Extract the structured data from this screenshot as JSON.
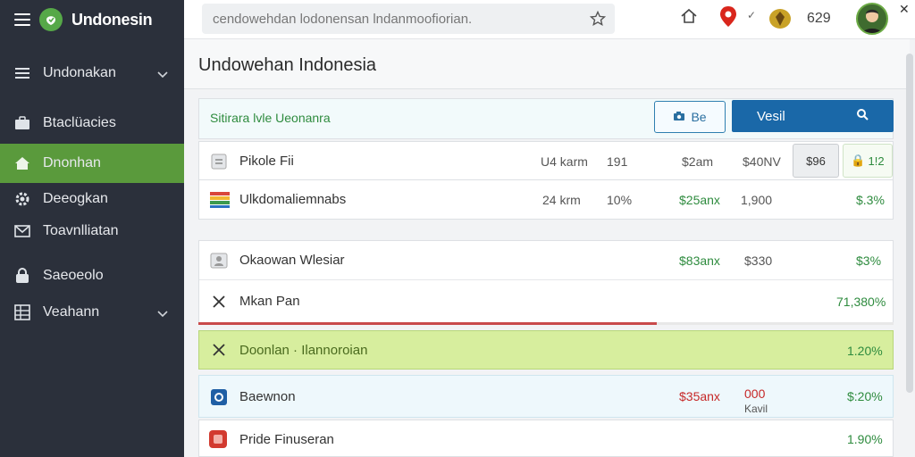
{
  "app": {
    "name": "Undonesin"
  },
  "sidebar": {
    "items": [
      {
        "label": "Undonakan",
        "icon": "list-icon",
        "chevron": true
      },
      {
        "label": "Btaclüacies",
        "icon": "briefcase-icon"
      },
      {
        "label": "Dnonhan",
        "icon": "home-icon",
        "active": true
      },
      {
        "label": "Deeogkan",
        "icon": "gear-icon"
      },
      {
        "label": "Toavnlliatan",
        "icon": "mail-icon"
      },
      {
        "label": "Saeoeolo",
        "icon": "lock-icon"
      },
      {
        "label": "Veahann",
        "icon": "grid-icon",
        "chevron": true
      }
    ]
  },
  "topbar": {
    "search_placeholder": "cendowehdan lodonensan lndanmoofiorian.",
    "count": "629"
  },
  "page": {
    "title": "Undowehan Indonesia"
  },
  "toolbar": {
    "label": "Sitirara lvle Ueonanra",
    "small_button": "Be",
    "primary_button": "Vesil"
  },
  "rows": [
    {
      "name": "Pikole Fii",
      "c1": "U4 karm",
      "c2": "191",
      "c3": "$2am",
      "c4": "$40NV",
      "btn1": "$96",
      "btn2": "1!2"
    },
    {
      "name": "Ulkdomaliemnabs",
      "c1": "24 krm",
      "c2": "10%",
      "c3": "$25anx",
      "c4": "1,900",
      "last": "$.3%"
    }
  ],
  "group": [
    {
      "name": "Okaowan Wlesiar",
      "c3": "$83anx",
      "c4": "$330",
      "last": "$3%"
    },
    {
      "name": "Mkan Pan",
      "last": "71,380%"
    }
  ],
  "progress": {
    "value": 0.66
  },
  "highlight": {
    "name": "Doonlan · Ilannoroian",
    "last": "1.20%"
  },
  "info": {
    "name": "Baewnon",
    "c3": "$35anx",
    "c4": "000",
    "c4b": "Kavil",
    "last": "$:20%"
  },
  "last_row": {
    "name": "Pride Finuseran",
    "last": "1.90%"
  },
  "colors": {
    "sidebar": "#2b303b",
    "accent_green": "#5a9a3c",
    "primary": "#1a68a8",
    "highlight": "#d7ee9e"
  }
}
